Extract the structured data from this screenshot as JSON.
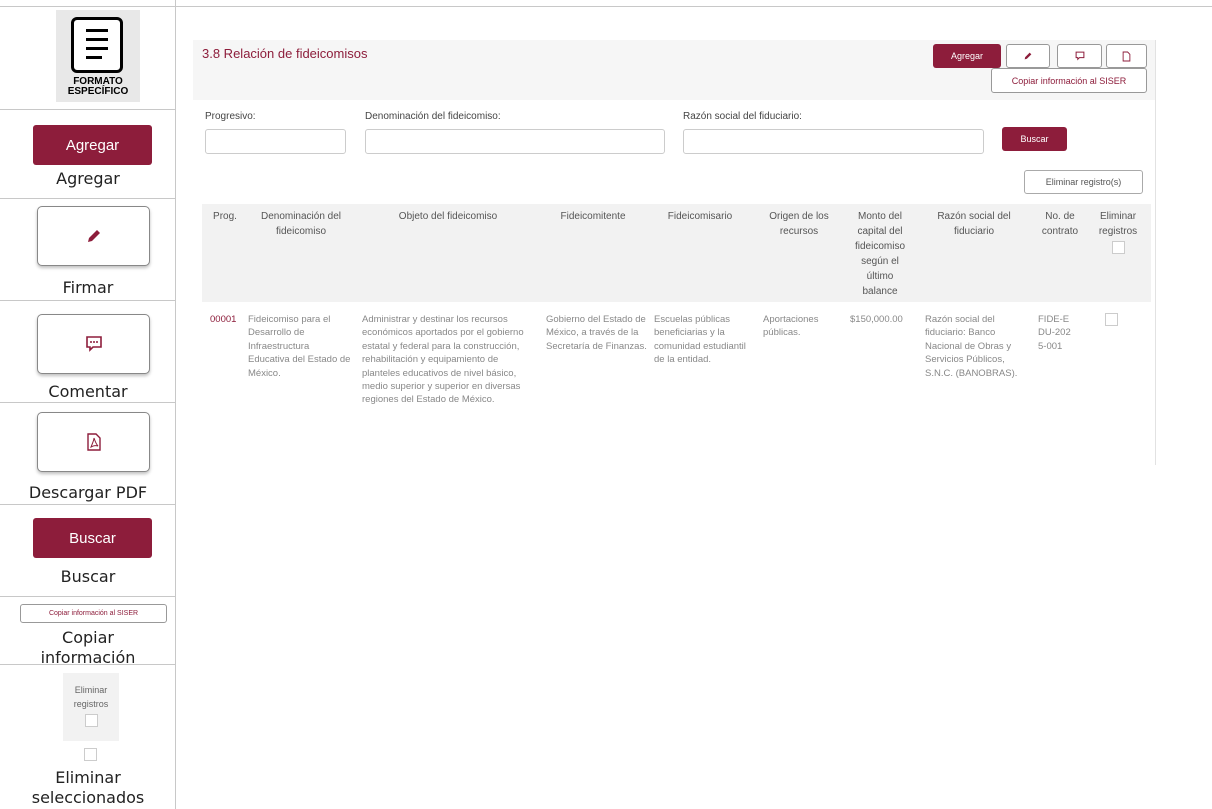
{
  "legend": {
    "logo_line1": "FORMATO",
    "logo_line2": "ESPECÍFICO",
    "agregar_button": "Agregar",
    "agregar_caption": "Agregar",
    "firmar_caption": "Firmar",
    "comentar_caption": "Comentar",
    "descargar_caption": "Descargar PDF",
    "buscar_button": "Buscar",
    "buscar_caption": "Buscar",
    "copiar_button": "Copiar información al SISER",
    "copiar_caption_1": "Copiar",
    "copiar_caption_2": "información",
    "eliminar_box_line1": "Eliminar",
    "eliminar_box_line2": "registros",
    "eliminar_caption_1": "Eliminar",
    "eliminar_caption_2": "seleccionados"
  },
  "panel": {
    "title": "3.8 Relación de fideicomisos",
    "agregar_label": "Agregar",
    "copiar_label": "Copiar información al SISER",
    "buscar_label": "Buscar",
    "eliminar_label": "Eliminar registro(s)"
  },
  "filters": {
    "progresivo_label": "Progresivo:",
    "denominacion_label": "Denominación del fideicomiso:",
    "razon_label": "Razón social del fiduciario:",
    "progresivo_value": "",
    "denominacion_value": "",
    "razon_value": ""
  },
  "table": {
    "headers": {
      "prog": "Prog.",
      "denominacion": "Denominación del fideicomiso",
      "objeto": "Objeto del fideicomiso",
      "fideicomitente": "Fideicomitente",
      "fideicomisario": "Fideicomisario",
      "origen": "Origen de los recursos",
      "monto": "Monto del capital del fideicomiso según el último balance",
      "razon": "Razón social del fiduciario",
      "contrato": "No. de contrato",
      "eliminar": "Eliminar registros"
    },
    "rows": [
      {
        "prog": "00001",
        "denominacion": "Fideicomiso para el Desarrollo de Infraestructura Educativa del Estado de México.",
        "objeto": "Administrar y destinar los recursos económicos aportados por el gobierno estatal y federal para la construcción, rehabilitación y equipamiento de planteles educativos de nivel básico, medio superior y superior en diversas regiones del Estado de México.",
        "fideicomitente": "Gobierno del Estado de México, a través de la Secretaría de Finanzas.",
        "fideicomisario": "Escuelas públicas beneficiarias y la comunidad estudiantil de la entidad.",
        "origen": "Aportaciones públicas.",
        "monto": "$150,000.00",
        "razon": "Razón social del fiduciario: Banco Nacional de Obras y Servicios Públicos, S.N.C. (BANOBRAS).",
        "contrato": "FIDE-EDU-2025-001"
      }
    ]
  },
  "colors": {
    "accent": "#8d1d3b",
    "header_bg": "#f6f6f6",
    "table_head_bg": "#f2f2f2"
  },
  "icons": [
    "document-icon",
    "pen-icon",
    "comment-icon",
    "pdf-icon"
  ]
}
